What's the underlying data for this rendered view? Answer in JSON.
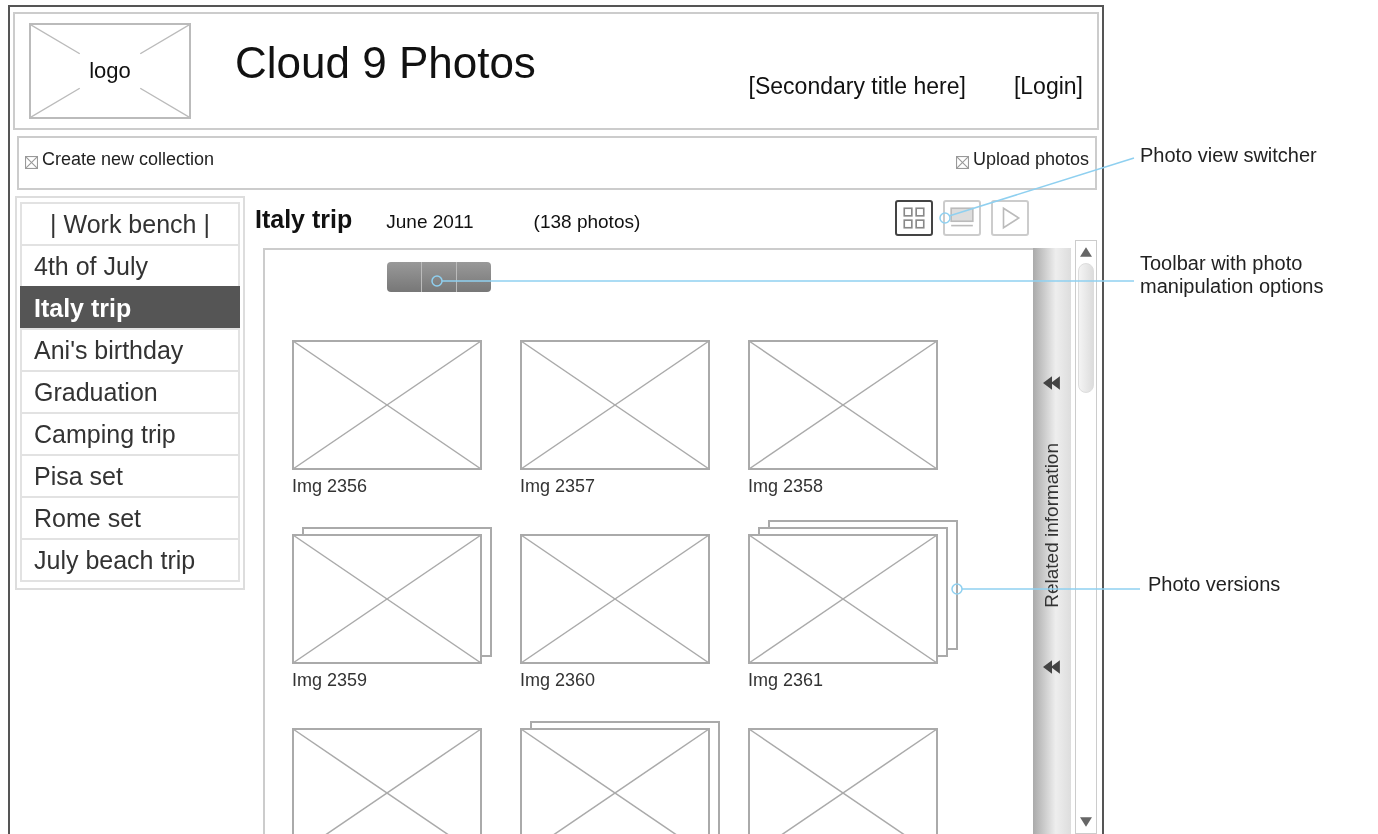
{
  "header": {
    "logo": "logo",
    "title": "Cloud 9 Photos",
    "secondary_title": "[Secondary title here]",
    "login": "[Login]"
  },
  "action_bar": {
    "create": "Create new collection",
    "upload": "Upload photos"
  },
  "sidebar": {
    "items": [
      {
        "label": "| Work bench |",
        "kind": "bench",
        "selected": false
      },
      {
        "label": "4th of July",
        "kind": "collection",
        "selected": false
      },
      {
        "label": "Italy trip",
        "kind": "collection",
        "selected": true
      },
      {
        "label": "Ani's birthday",
        "kind": "collection",
        "selected": false
      },
      {
        "label": "Graduation",
        "kind": "collection",
        "selected": false
      },
      {
        "label": "Camping trip",
        "kind": "collection",
        "selected": false
      },
      {
        "label": "Pisa set",
        "kind": "collection",
        "selected": false
      },
      {
        "label": "Rome set",
        "kind": "collection",
        "selected": false
      },
      {
        "label": "July beach trip",
        "kind": "collection",
        "selected": false
      }
    ]
  },
  "album": {
    "title": "Italy trip",
    "date": "June 2011",
    "count": "(138 photos)"
  },
  "view_switcher": [
    {
      "kind": "grid",
      "selected": true
    },
    {
      "kind": "filmstrip",
      "selected": false
    },
    {
      "kind": "slideshow",
      "selected": false
    }
  ],
  "related_panel": {
    "label": "Related information"
  },
  "photos": [
    {
      "label": "Img 2356",
      "kind": "single"
    },
    {
      "label": "Img 2357",
      "kind": "single"
    },
    {
      "label": "Img 2358",
      "kind": "single"
    },
    {
      "label": "Img 2359",
      "kind": "double"
    },
    {
      "label": "Img 2360",
      "kind": "single"
    },
    {
      "label": "Img 2361",
      "kind": "triple"
    },
    {
      "kind": "single"
    },
    {
      "kind": "double"
    },
    {
      "kind": "single"
    }
  ],
  "annotations": [
    {
      "lines": [
        "Photo view switcher"
      ]
    },
    {
      "lines": [
        "Toolbar with photo",
        "manipulation options"
      ]
    },
    {
      "lines": [
        "Photo versions"
      ]
    }
  ]
}
